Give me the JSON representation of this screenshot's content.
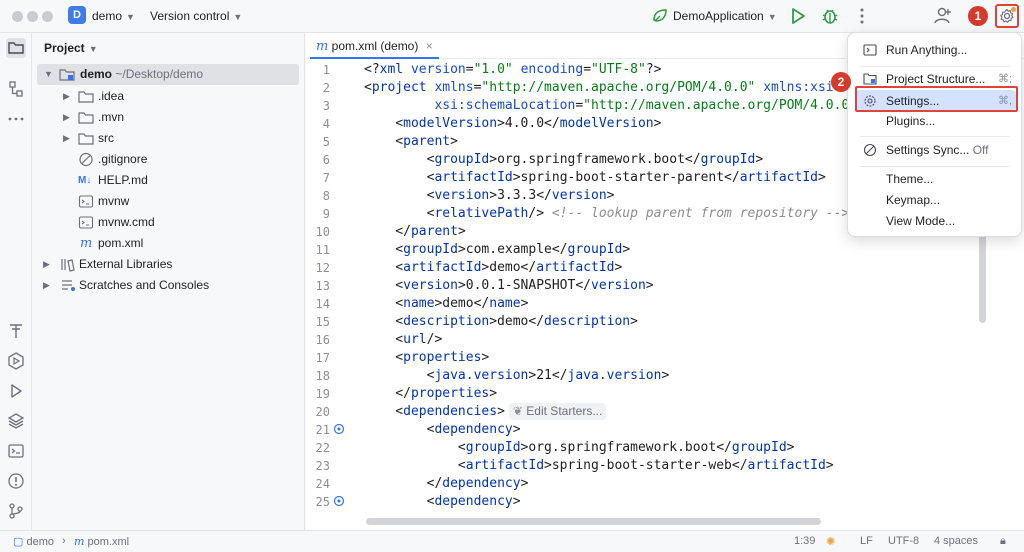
{
  "titlebar": {
    "project_initial": "D",
    "project_name": "demo",
    "vcs_label": "Version control",
    "run_config": "DemoApplication",
    "marker_1": "1",
    "marker_2": "2"
  },
  "project_panel": {
    "header": "Project",
    "root_name": "demo",
    "root_path": "~/Desktop/demo",
    "items": [
      {
        "label": ".idea",
        "kind": "folder"
      },
      {
        "label": ".mvn",
        "kind": "folder"
      },
      {
        "label": "src",
        "kind": "folder"
      },
      {
        "label": ".gitignore",
        "kind": "ignore"
      },
      {
        "label": "HELP.md",
        "kind": "markdown"
      },
      {
        "label": "mvnw",
        "kind": "script"
      },
      {
        "label": "mvnw.cmd",
        "kind": "script"
      },
      {
        "label": "pom.xml",
        "kind": "maven"
      },
      {
        "label": "External Libraries",
        "kind": "library"
      },
      {
        "label": "Scratches and Consoles",
        "kind": "scratch"
      }
    ]
  },
  "editor": {
    "tab_label": "pom.xml (demo)",
    "line_numbers": [
      "1",
      "2",
      "3",
      "4",
      "5",
      "6",
      "7",
      "8",
      "9",
      "10",
      "11",
      "12",
      "13",
      "14",
      "15",
      "16",
      "17",
      "18",
      "19",
      "20",
      "21",
      "22",
      "23",
      "24",
      "25"
    ],
    "edit_starters_hint": "Edit Starters..."
  },
  "menu": {
    "items": [
      {
        "label": "Run Anything...",
        "shortcut": ""
      },
      {
        "label": "Project Structure...",
        "shortcut": "⌘;"
      },
      {
        "label": "Settings...",
        "shortcut": "⌘,"
      },
      {
        "label": "Plugins...",
        "shortcut": ""
      },
      {
        "label": "Settings Sync...",
        "shortcut": "",
        "suffix": "Off"
      },
      {
        "label": "Theme...",
        "shortcut": ""
      },
      {
        "label": "Keymap...",
        "shortcut": ""
      },
      {
        "label": "View Mode...",
        "shortcut": ""
      }
    ]
  },
  "statusbar": {
    "crumb_project": "demo",
    "crumb_file": "pom.xml",
    "position": "1:39",
    "line_sep": "LF",
    "encoding": "UTF-8",
    "indent": "4 spaces"
  },
  "colors": {
    "accent": "#3574f0",
    "marker": "#d63a2a",
    "xml_tag": "#0033b3",
    "xml_string": "#067d17",
    "run_green": "#2f9e44"
  }
}
